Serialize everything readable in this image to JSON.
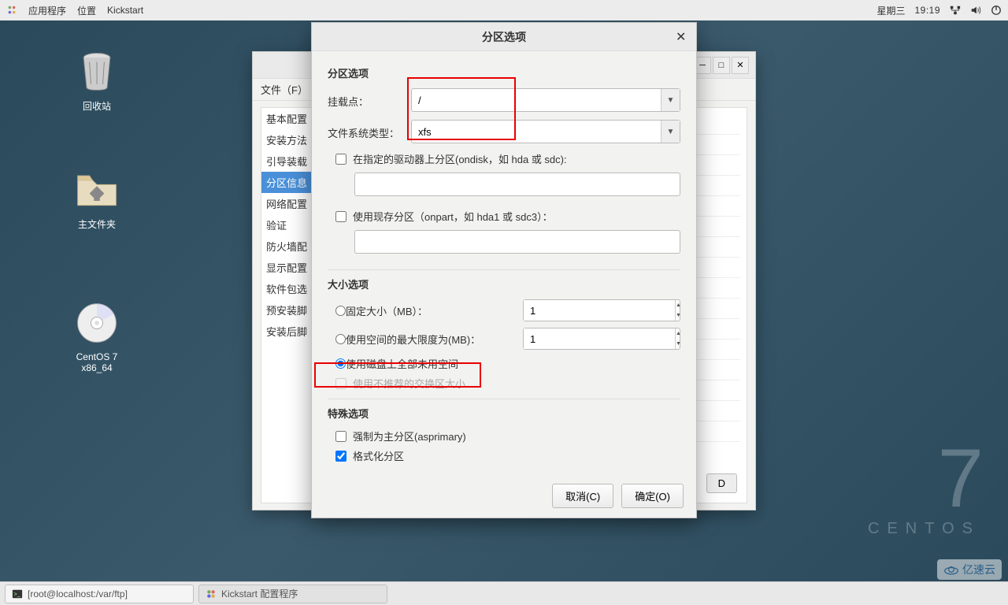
{
  "panel": {
    "menu_apps": "应用程序",
    "menu_places": "位置",
    "menu_appname": "Kickstart",
    "clock_day": "星期三",
    "clock_time": "19:19"
  },
  "desktop": {
    "trash": "回收站",
    "home": "主文件夹",
    "disc": "CentOS 7 x86_64"
  },
  "watermark": {
    "big": "7",
    "brand": "CENTOS",
    "cloud": "亿速云"
  },
  "bg_window": {
    "menubar_file": "文件（F）",
    "sidebar": [
      "基本配置",
      "安装方法",
      "引导装载",
      "分区信息",
      "网络配置",
      "验证",
      "防火墙配",
      "显示配置",
      "软件包选",
      "预安装脚",
      "安装后脚"
    ],
    "sidebar_selected_index": 3,
    "delete_btn": "D"
  },
  "dialog": {
    "title": "分区选项",
    "section_partition": "分区选项",
    "lbl_mount": "挂载点：",
    "val_mount": "/",
    "lbl_fstype": "文件系统类型：",
    "val_fstype": "xfs",
    "chk_ondisk": "在指定的驱动器上分区(ondisk，如 hda 或 sdc):",
    "chk_onpart": "使用现存分区（onpart，如 hda1 或 sdc3）：",
    "section_size": "大小选项",
    "radio_fixed": "固定大小（MB）：",
    "val_fixed": "1",
    "radio_maxsize": "使用空间的最大限度为(MB)：",
    "val_maxsize": "1",
    "radio_fill": "使用磁盘上全部未用空间",
    "chk_swap": "使用不推荐的交换区大小",
    "section_special": "特殊选项",
    "chk_primary": "强制为主分区(asprimary)",
    "chk_format": "格式化分区",
    "btn_cancel": "取消(C)",
    "btn_ok": "确定(O)"
  },
  "taskbar": {
    "term": "[root@localhost:/var/ftp]",
    "kick": "Kickstart 配置程序"
  }
}
